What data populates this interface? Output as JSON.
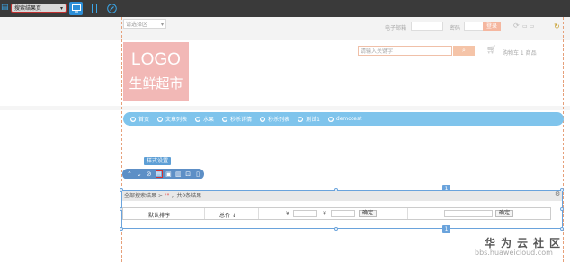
{
  "toolbar": {
    "page_select_value": "搜索结果页",
    "menu_icon": "grid-icon",
    "views": [
      "desktop-icon",
      "mobile-icon",
      "link-icon"
    ]
  },
  "header": {
    "region_select": "请选择区",
    "email_label": "电子邮箱",
    "password_label": "密码",
    "login_button": "登录",
    "logo_line1": "LOGO",
    "logo_line2": "生鲜超市",
    "search_placeholder": "请输入关键字",
    "search_icon": "search-icon",
    "cart_icon": "cart-icon",
    "cart_text": "购物车 1 商品"
  },
  "nav": {
    "items": [
      {
        "label": "首页"
      },
      {
        "label": "文章列表"
      },
      {
        "label": "水果"
      },
      {
        "label": "秒杀详情"
      },
      {
        "label": "秒杀列表"
      },
      {
        "label": "测试1"
      },
      {
        "label": "demotest"
      }
    ]
  },
  "editor": {
    "style_tip": "样式设置",
    "tool_icons": [
      "arrow-up-icon",
      "arrow-down-icon",
      "link-icon",
      "style-settings-icon",
      "layout-icon",
      "edit-icon",
      "lock-icon",
      "delete-icon"
    ],
    "badge_top": "1",
    "badge_bottom": "1"
  },
  "results": {
    "crumb_prefix": "全部搜索结果",
    "crumb_sep": ">",
    "crumb_quote": "\"\"",
    "crumb_count_text": "，共0条结果",
    "sort_default": "默认排序",
    "sort_price": "总价 ⇃",
    "currency1": "¥",
    "range_sep": "- ¥",
    "confirm1": "确定",
    "confirm2": "确定"
  },
  "watermark": {
    "line1": "华为云社区",
    "line2": "bbs.huaweicloud.com"
  },
  "colors": {
    "accent_blue": "#2d8fd8",
    "nav_blue": "#7fc4ec",
    "logo_pink": "#f2b8b6",
    "selection_blue": "#6aa3dc"
  }
}
